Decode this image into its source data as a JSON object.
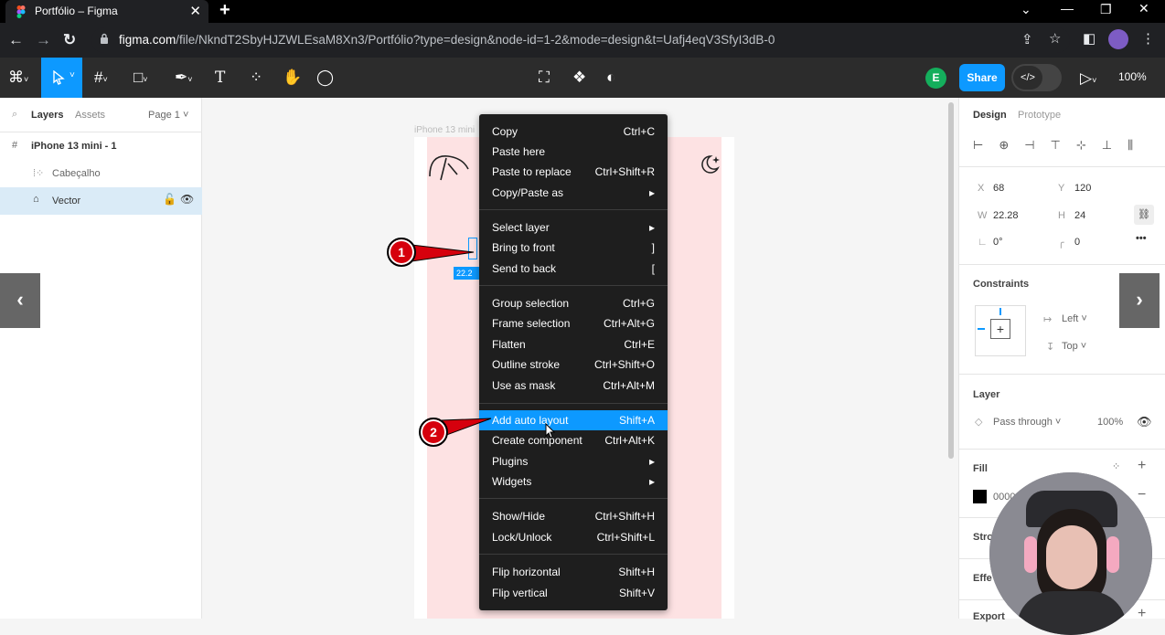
{
  "browser": {
    "tab_title": "Portfólio – Figma",
    "tab_close": "✕",
    "new_tab": "+",
    "url_domain": "figma.com",
    "url_path": "/file/NkndT2SbyHJZWLEsaM8Xn3/Portfólio?type=design&node-id=1-2&mode=design&t=Uafj4eqV3SfyI3dB-0"
  },
  "toolbar": {
    "share_label": "Share",
    "avatar_letter": "E",
    "zoom": "100%"
  },
  "left_panel": {
    "tabs": [
      "Layers",
      "Assets"
    ],
    "page": "Page 1",
    "layers": [
      {
        "label": "iPhone 13 mini - 1"
      },
      {
        "label": "Cabeçalho"
      },
      {
        "label": "Vector"
      }
    ]
  },
  "canvas": {
    "frame_label": "iPhone 13 mini",
    "size_badge": "22.2"
  },
  "context_menu": {
    "groups": [
      [
        {
          "label": "Copy",
          "shortcut": "Ctrl+C"
        },
        {
          "label": "Paste here",
          "shortcut": ""
        },
        {
          "label": "Paste to replace",
          "shortcut": "Ctrl+Shift+R"
        },
        {
          "label": "Copy/Paste as",
          "shortcut": "▸"
        }
      ],
      [
        {
          "label": "Select layer",
          "shortcut": "▸"
        },
        {
          "label": "Bring to front",
          "shortcut": "]"
        },
        {
          "label": "Send to back",
          "shortcut": "["
        }
      ],
      [
        {
          "label": "Group selection",
          "shortcut": "Ctrl+G"
        },
        {
          "label": "Frame selection",
          "shortcut": "Ctrl+Alt+G"
        },
        {
          "label": "Flatten",
          "shortcut": "Ctrl+E"
        },
        {
          "label": "Outline stroke",
          "shortcut": "Ctrl+Shift+O"
        },
        {
          "label": "Use as mask",
          "shortcut": "Ctrl+Alt+M"
        }
      ],
      [
        {
          "label": "Add auto layout",
          "shortcut": "Shift+A",
          "highlighted": true
        },
        {
          "label": "Create component",
          "shortcut": "Ctrl+Alt+K"
        },
        {
          "label": "Plugins",
          "shortcut": "▸"
        },
        {
          "label": "Widgets",
          "shortcut": "▸"
        }
      ],
      [
        {
          "label": "Show/Hide",
          "shortcut": "Ctrl+Shift+H"
        },
        {
          "label": "Lock/Unlock",
          "shortcut": "Ctrl+Shift+L"
        }
      ],
      [
        {
          "label": "Flip horizontal",
          "shortcut": "Shift+H"
        },
        {
          "label": "Flip vertical",
          "shortcut": "Shift+V"
        }
      ]
    ]
  },
  "right_panel": {
    "tabs": [
      "Design",
      "Prototype"
    ],
    "x_label": "X",
    "x": "68",
    "y_label": "Y",
    "y": "120",
    "w_label": "W",
    "w": "22.28",
    "h_label": "H",
    "h": "24",
    "rotation": "0°",
    "radius": "0",
    "constraints_title": "Constraints",
    "constraint_h": "Left",
    "constraint_v": "Top",
    "layer_title": "Layer",
    "blend": "Pass through",
    "opacity": "100%",
    "fill_title": "Fill",
    "fill_hex": "000000",
    "stroke_title": "Strok",
    "effects_title": "Effe",
    "export_title": "Export"
  },
  "callouts": [
    "1",
    "2"
  ],
  "colors": {
    "accent": "#0d99ff",
    "callout": "#d6000d",
    "frame_fill": "#fde2e3"
  }
}
